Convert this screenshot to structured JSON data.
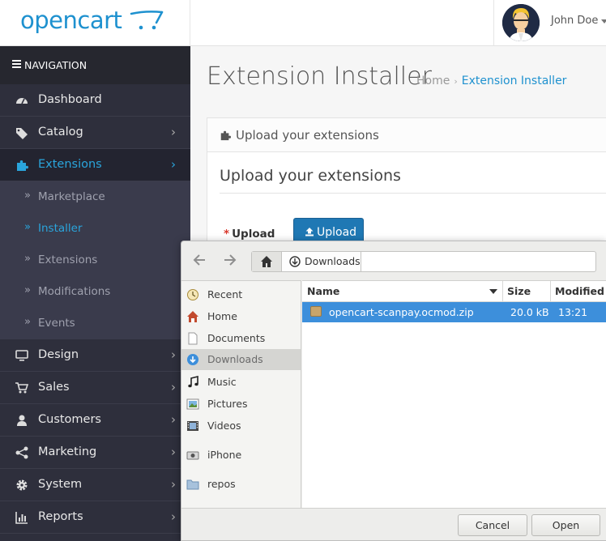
{
  "header": {
    "logo_text": "opencart",
    "user_name": "John Doe"
  },
  "sidebar": {
    "nav_title": "NAVIGATION",
    "items": [
      {
        "label": "Dashboard",
        "icon": "dashboard-icon",
        "has_children": false
      },
      {
        "label": "Catalog",
        "icon": "tags-icon",
        "has_children": true
      },
      {
        "label": "Extensions",
        "icon": "puzzle-icon",
        "has_children": true,
        "active": true
      },
      {
        "label": "Design",
        "icon": "monitor-icon",
        "has_children": true
      },
      {
        "label": "Sales",
        "icon": "cart-icon",
        "has_children": true
      },
      {
        "label": "Customers",
        "icon": "user-icon",
        "has_children": true
      },
      {
        "label": "Marketing",
        "icon": "share-icon",
        "has_children": true
      },
      {
        "label": "System",
        "icon": "cog-icon",
        "has_children": true
      },
      {
        "label": "Reports",
        "icon": "bar-chart-icon",
        "has_children": true
      }
    ],
    "extensions_submenu": [
      {
        "label": "Marketplace",
        "active": false
      },
      {
        "label": "Installer",
        "active": true
      },
      {
        "label": "Extensions",
        "active": false
      },
      {
        "label": "Modifications",
        "active": false
      },
      {
        "label": "Events",
        "active": false
      }
    ]
  },
  "main": {
    "page_title": "Extension Installer",
    "breadcrumb": {
      "home": "Home",
      "current": "Extension Installer"
    },
    "panel_title": "Upload your extensions",
    "legend": "Upload your extensions",
    "upload_label": "Upload",
    "upload_required_mark": "*",
    "upload_button": "Upload"
  },
  "file_dialog": {
    "path": [
      "home",
      "Downloads"
    ],
    "places": [
      {
        "label": "Recent",
        "icon": "recent-icon"
      },
      {
        "label": "Home",
        "icon": "home-icon"
      },
      {
        "label": "Documents",
        "icon": "document-icon"
      },
      {
        "label": "Downloads",
        "icon": "download-icon",
        "selected": true
      },
      {
        "label": "Music",
        "icon": "music-icon"
      },
      {
        "label": "Pictures",
        "icon": "pictures-icon"
      },
      {
        "label": "Videos",
        "icon": "videos-icon"
      },
      {
        "label": "iPhone",
        "icon": "iphone-icon"
      },
      {
        "label": "repos",
        "icon": "folder-icon"
      }
    ],
    "columns": {
      "name": "Name",
      "size": "Size",
      "modified": "Modified"
    },
    "files": [
      {
        "name": "opencart-scanpay.ocmod.zip",
        "size": "20.0 kB",
        "modified": "13:21",
        "selected": true
      }
    ],
    "cancel_label": "Cancel",
    "open_label": "Open"
  },
  "colors": {
    "brand_blue": "#1e91cf",
    "sidebar_bg": "#2e2f3c",
    "active_link": "#2aa5dc",
    "selection_blue": "#3d8fdb",
    "required_red": "#d9372b"
  }
}
